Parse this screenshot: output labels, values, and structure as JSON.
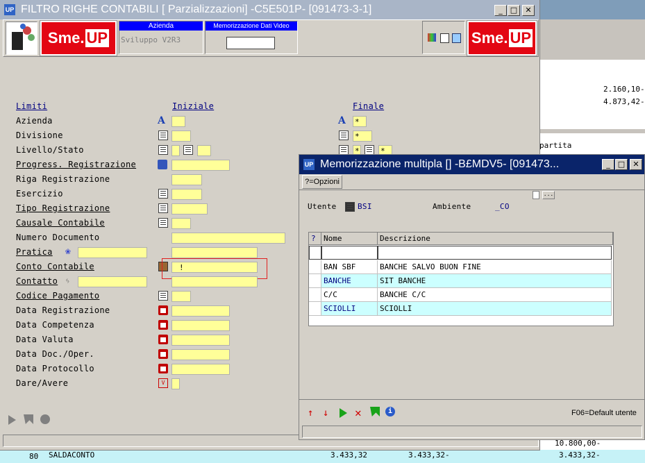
{
  "main_window": {
    "title": "FILTRO RIGHE CONTABILI [ Parzializzazioni] -C5E501P- [091473-3-1]",
    "azienda_label": "Azienda",
    "azienda_value": "Sviluppo V2R3",
    "mem_label": "Memorizzazione Dati Video",
    "logo_text": "Sme.",
    "logo_up": "UP",
    "headers": {
      "limiti": "Limiti",
      "iniziale": "Iniziale",
      "finale": "Finale"
    },
    "rows": [
      "Azienda",
      "Divisione",
      "Livello/Stato",
      "Progress. Registrazione",
      "Riga Registrazione",
      "Esercizio",
      "Tipo Registrazione",
      "Causale Contabile",
      "Numero Documento",
      "Pratica",
      "Conto Contabile",
      "Contatto",
      "Codice Pagamento",
      "Data Registrazione",
      "Data Competenza",
      "Data Valuta",
      "Data Doc./Oper.",
      "Data Protocollo",
      "Dare/Avere"
    ],
    "finale_values": {
      "azienda": "*",
      "divisione": "*",
      "livello1": "*",
      "livello2": "*"
    },
    "conto_marker": "!"
  },
  "background": {
    "values": [
      "2.160,10-",
      "4.873,42-"
    ],
    "partita_label": "partita",
    "bottom_value": "10.800,00-",
    "bottom_row": {
      "num": "80",
      "desc": "SALDACONTO",
      "v1": "3.433,32",
      "v2": "3.433,32-",
      "v3": "3.433,32-"
    }
  },
  "dialog": {
    "title": "Memorizzazione multipla [] -B£MDV5- [091473...",
    "options_button": "?=Opzioni",
    "utente_label": "Utente",
    "utente_value": "BSI",
    "ambiente_label": "Ambiente",
    "ambiente_value": "_CO",
    "columns": {
      "q": "?",
      "nome": "Nome",
      "descrizione": "Descrizione"
    },
    "rows": [
      {
        "nome": "BAN SBF",
        "descrizione": "BANCHE SALVO BUON FINE"
      },
      {
        "nome": "BANCHE",
        "descrizione": "SIT BANCHE"
      },
      {
        "nome": "C/C",
        "descrizione": "BANCHE C/C"
      },
      {
        "nome": "SCIOLLI",
        "descrizione": "SCIOLLI"
      }
    ],
    "status_text": "F06=Default utente",
    "colors": {
      "row_alt": "#ccffff",
      "title_bar": "#0a246a"
    }
  }
}
